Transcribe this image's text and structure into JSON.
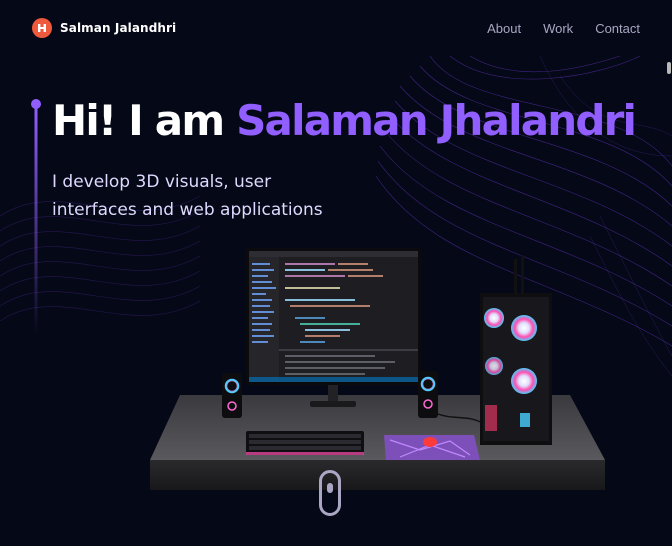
{
  "nav": {
    "brand": "Salman Jalandhri",
    "links": [
      {
        "label": "About"
      },
      {
        "label": "Work"
      },
      {
        "label": "Contact"
      }
    ]
  },
  "hero": {
    "greeting": "Hi! I am ",
    "name": "Salaman Jhalandri",
    "subtitle": "I develop 3D visuals, user interfaces and web applications"
  },
  "colors": {
    "background": "#050816",
    "accent": "#915eff",
    "nav_text": "#aaa6c3",
    "logo": "#ef5a3c"
  },
  "icons": {
    "logo": "logo-icon",
    "scroll": "mouse-scroll-icon"
  }
}
